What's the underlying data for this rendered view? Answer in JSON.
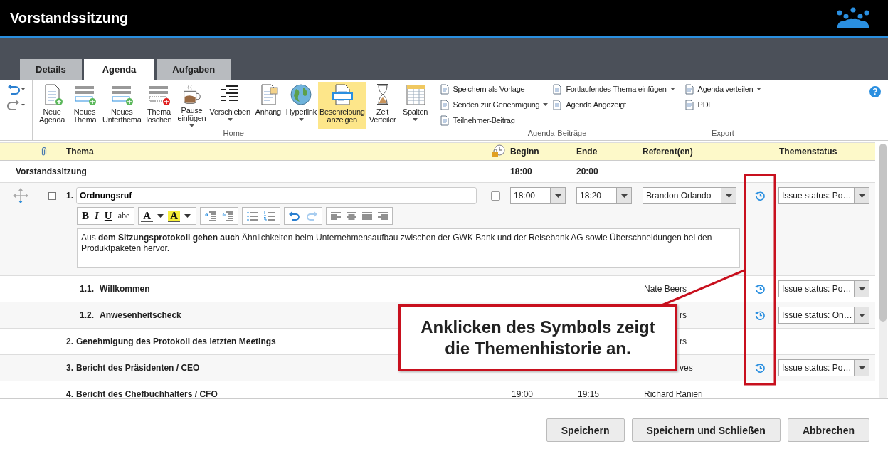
{
  "window": {
    "title": "Vorstandssitzung"
  },
  "tabs": [
    {
      "label": "Details",
      "selected": false
    },
    {
      "label": "Agenda",
      "selected": true
    },
    {
      "label": "Aufgaben",
      "selected": false
    }
  ],
  "ribbon": {
    "groups": [
      {
        "label": "Home",
        "items": [
          {
            "label": "Neue Agenda",
            "dropdown": false,
            "highlighted": false
          },
          {
            "label": "Neues Thema",
            "dropdown": false,
            "highlighted": false
          },
          {
            "label": "Neues Unterthema",
            "dropdown": false,
            "highlighted": false
          },
          {
            "label": "Thema löschen",
            "dropdown": false,
            "highlighted": false
          },
          {
            "label": "Pause einfügen",
            "dropdown": true,
            "highlighted": false
          },
          {
            "label": "Verschieben",
            "dropdown": true,
            "highlighted": false
          },
          {
            "label": "Anhang",
            "dropdown": false,
            "highlighted": false
          },
          {
            "label": "Hyperlink",
            "dropdown": true,
            "highlighted": false
          },
          {
            "label": "Beschreibung anzeigen",
            "dropdown": false,
            "highlighted": true
          },
          {
            "label": "Zeit Verteiler",
            "dropdown": false,
            "highlighted": false
          },
          {
            "label": "Spalten",
            "dropdown": true,
            "highlighted": false
          }
        ]
      },
      {
        "label": "Agenda-Beiträge",
        "columns": [
          [
            {
              "label": "Speichern als Vorlage",
              "dropdown": false
            },
            {
              "label": "Senden zur Genehmigung",
              "dropdown": true
            },
            {
              "label": "Teilnehmer-Beitrag",
              "dropdown": false
            }
          ],
          [
            {
              "label": "Fortlaufendes Thema einfügen",
              "dropdown": true
            },
            {
              "label": "Agenda Angezeigt",
              "dropdown": false
            }
          ]
        ]
      },
      {
        "label": "Export",
        "columns": [
          [
            {
              "label": "Agenda verteilen",
              "dropdown": true
            },
            {
              "label": "PDF",
              "dropdown": false
            }
          ]
        ]
      }
    ],
    "help": "?"
  },
  "agenda": {
    "columns": {
      "topic": "Thema",
      "begin": "Beginn",
      "end": "Ende",
      "speakers": "Referent(en)",
      "status": "Themenstatus"
    },
    "meeting": {
      "title": "Vorstandssitzung",
      "begin": "18:00",
      "end": "20:00"
    },
    "rows": [
      {
        "number": "1.",
        "title": "Ordnungsruf",
        "expanded": true,
        "checked": false,
        "begin": "18:00",
        "end": "18:20",
        "speaker": "Brandon Orlando",
        "history": true,
        "status": "Issue status: Po…",
        "editor": {
          "format_buttons": [
            "B",
            "I",
            "U",
            "abe"
          ],
          "color_buttons": [
            "A",
            "A"
          ],
          "description": "Aus **dem Sitzungsprotokoll gehen auc**h Ähnlichkeiten beim Unternehmensaufbau zwischen der GWK Bank und der Reisebank AG sowie Überschneidungen bei den Produktpaketen hervor."
        },
        "children": [
          {
            "number": "1.1.",
            "title": "Willkommen",
            "speaker": "Nate Beers",
            "history": true,
            "status": "Issue status: Po…"
          },
          {
            "number": "1.2.",
            "title": "Anwesenheitscheck",
            "speaker": "rs",
            "speaker_cut": true,
            "history": true,
            "status": "Issue status: On…"
          }
        ]
      },
      {
        "number": "2.",
        "title": "Genehmigung des Protokoll des letzten Meetings",
        "speaker": "rs",
        "speaker_cut": true,
        "history": false
      },
      {
        "number": "3.",
        "title": "Bericht des Präsidenten / CEO",
        "speaker": "ves",
        "speaker_cut": true,
        "history": true,
        "status": "Issue status: Po…"
      },
      {
        "number": "4.",
        "title": "Bericht des Chefbuchhalters / CFO",
        "begin": "19:00",
        "end": "19:15",
        "speaker": "Richard Ranieri",
        "history": false
      }
    ]
  },
  "buttons": [
    "Speichern",
    "Speichern und Schließen",
    "Abbrechen"
  ],
  "callout": {
    "text": "Anklicken des Symbols zeigt die Themenhistorie an."
  }
}
